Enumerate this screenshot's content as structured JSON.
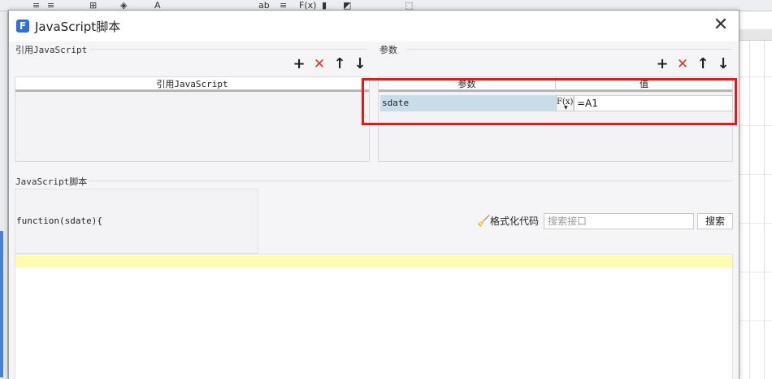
{
  "background_app": {
    "toolbar_glyphs": [
      "≡",
      "≡",
      "⊞",
      "◈",
      "A",
      "ab",
      "≡",
      "F(x)",
      "▮",
      "◩",
      "⬚"
    ]
  },
  "dialog": {
    "title": "JavaScript脚本",
    "logo_letter": "F",
    "close_label": "✕"
  },
  "left_section": {
    "label": "引用JavaScript",
    "column_header": "引用JavaScript",
    "buttons": {
      "add": "+",
      "delete": "✕",
      "up": "↑",
      "down": "↓"
    }
  },
  "right_section": {
    "label": "参数",
    "columns": {
      "param": "参数",
      "value": "值"
    },
    "rows": [
      {
        "name": "sdate",
        "fx": "F(x)",
        "value": "=A1"
      }
    ],
    "buttons": {
      "add": "+",
      "delete": "✕",
      "up": "↑",
      "down": "↓"
    }
  },
  "script_section": {
    "label": "JavaScript脚本",
    "function_signature": "function(sdate){",
    "format_label": "格式化代码",
    "search_placeholder": "搜索接口",
    "search_button": "搜索"
  },
  "colors": {
    "highlight_box": "#e61919",
    "delete_icon": "#e0312b",
    "current_line": "#fffcb0",
    "selected_param": "#c8dcea"
  }
}
